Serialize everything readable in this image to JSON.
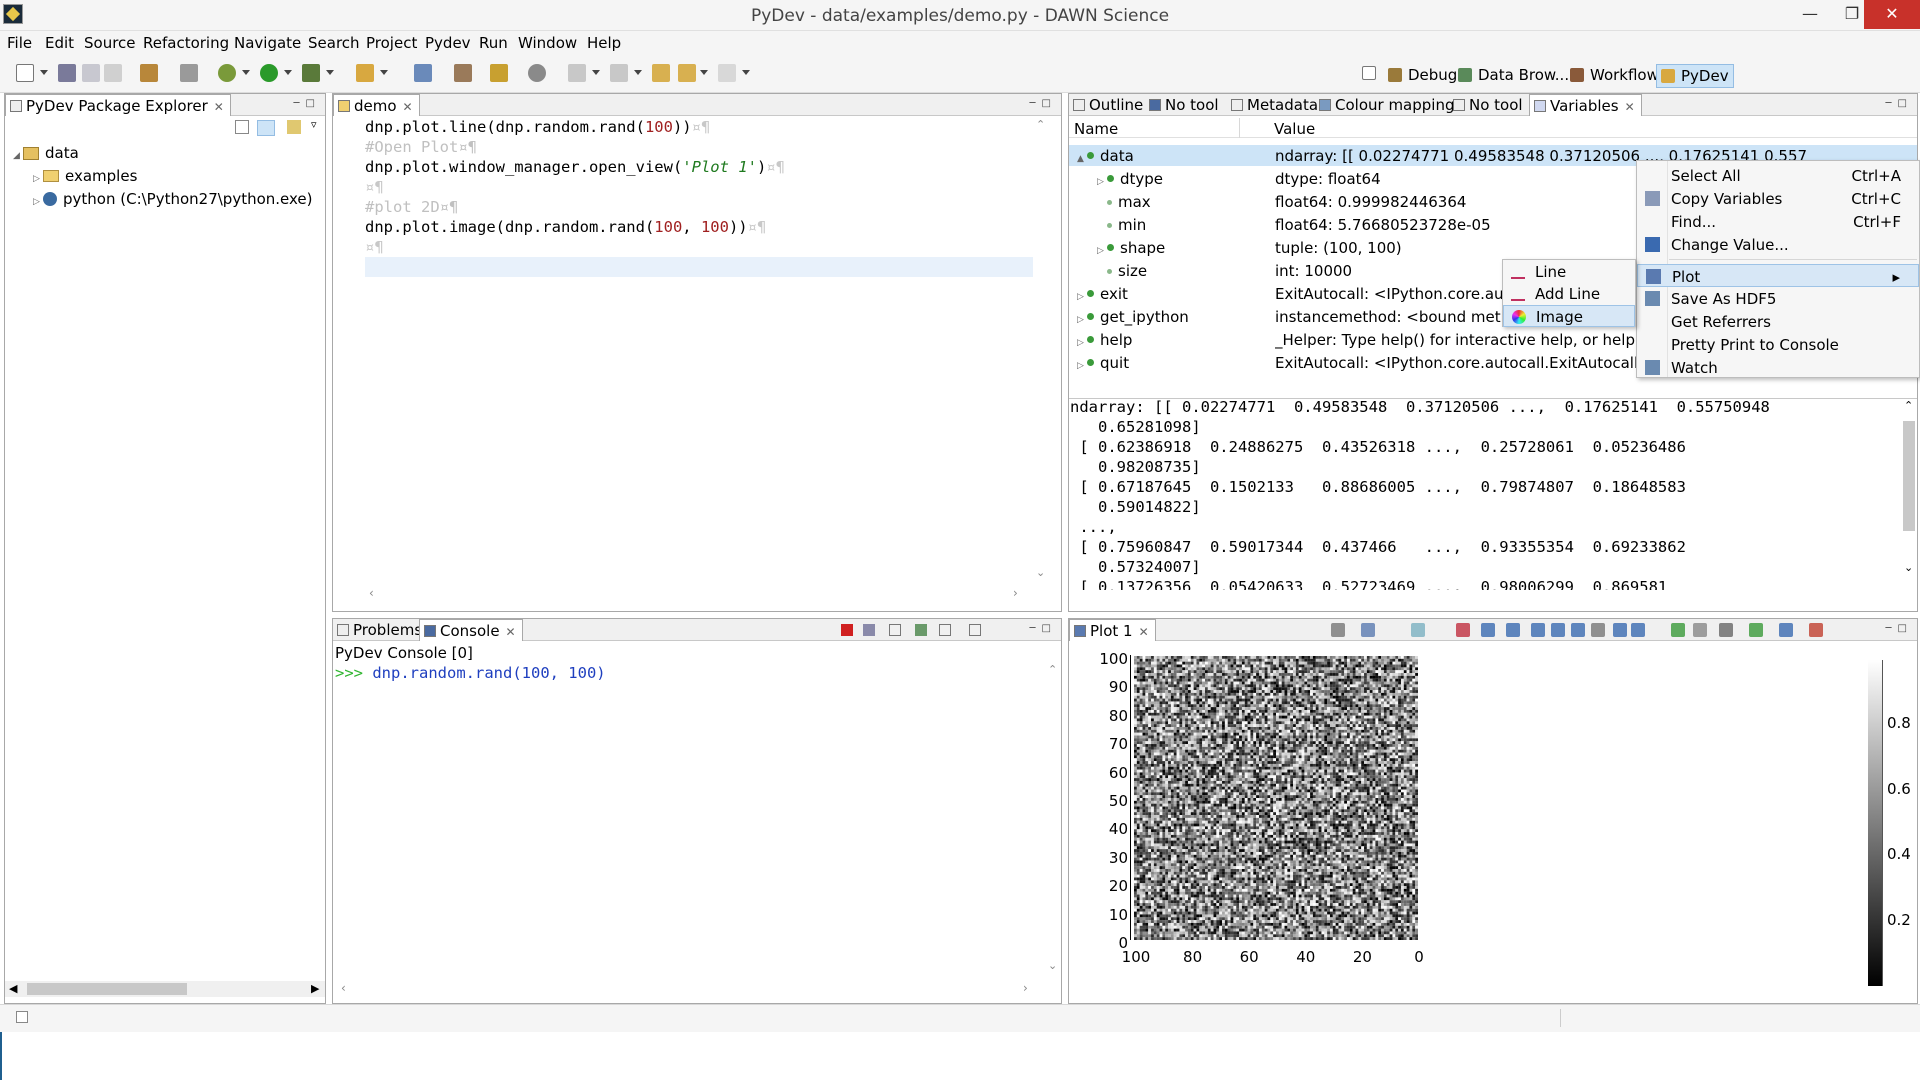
{
  "window": {
    "title": "PyDev - data/examples/demo.py - DAWN Science"
  },
  "menu": [
    "File",
    "Edit",
    "Source",
    "Refactoring",
    "Navigate",
    "Search",
    "Project",
    "Pydev",
    "Run",
    "Window",
    "Help"
  ],
  "perspectives": [
    "Debug",
    "Data Brow...",
    "Workflow",
    "PyDev"
  ],
  "explorer": {
    "tab": "PyDev Package Explorer",
    "root": "data",
    "children": [
      "examples",
      "python  (C:\\Python27\\python.exe)"
    ]
  },
  "editor": {
    "tab": "demo",
    "lines": [
      {
        "type": "code",
        "parts": [
          [
            "dnp.plot.line(dnp.random.rand(",
            ""
          ],
          [
            "100",
            "num"
          ],
          [
            "))",
            ""
          ],
          [
            "¤¶",
            "ws"
          ]
        ]
      },
      {
        "type": "code",
        "parts": [
          [
            "#Open Plot¤¶",
            "comment"
          ]
        ]
      },
      {
        "type": "code",
        "parts": [
          [
            "dnp.plot.window_manager.open_view(",
            ""
          ],
          [
            "'Plot 1'",
            "str"
          ],
          [
            ")",
            ""
          ],
          [
            "¤¶",
            "ws"
          ]
        ]
      },
      {
        "type": "code",
        "parts": [
          [
            "¤¶",
            "ws"
          ]
        ]
      },
      {
        "type": "code",
        "parts": [
          [
            "#plot 2D¤¶",
            "comment"
          ]
        ]
      },
      {
        "type": "code",
        "parts": [
          [
            "dnp.plot.image(dnp.random.rand(",
            ""
          ],
          [
            "100",
            "num"
          ],
          [
            ", ",
            ""
          ],
          [
            "100",
            "num"
          ],
          [
            "))",
            ""
          ],
          [
            "¤¶",
            "ws"
          ]
        ]
      },
      {
        "type": "code",
        "parts": [
          [
            "¤¶",
            "ws"
          ]
        ]
      }
    ]
  },
  "var_tabs": [
    "Outline",
    "No tool",
    "Metadata",
    "Colour mapping",
    "No tool",
    "Variables"
  ],
  "variables": {
    "col_name": "Name",
    "col_value": "Value",
    "rows": [
      {
        "name": "data",
        "value": "ndarray: [[ 0.02274771  0.49583548  0.37120506 ...,  0.17625141  0.557",
        "level": 0,
        "arrow": "▲",
        "selected": true
      },
      {
        "name": "dtype",
        "value": "dtype: float64",
        "level": 1,
        "arrow": "▷"
      },
      {
        "name": "max",
        "value": "float64: 0.999982446364",
        "level": 1,
        "arrow": ""
      },
      {
        "name": "min",
        "value": "float64: 5.76680523728e-05",
        "level": 1,
        "arrow": ""
      },
      {
        "name": "shape",
        "value": "tuple: (100, 100)",
        "level": 1,
        "arrow": "▷"
      },
      {
        "name": "size",
        "value": "int: 10000",
        "level": 1,
        "arrow": ""
      },
      {
        "name": "exit",
        "value": "ExitAutocall: <IPython.core.autoca",
        "level": 0,
        "arrow": "▷"
      },
      {
        "name": "get_ipython",
        "value": "instancemethod: <bound method",
        "level": 0,
        "arrow": "▷"
      },
      {
        "name": "help",
        "value": "_Helper: Type help() for interactive help, or help(objec",
        "level": 0,
        "arrow": "▷"
      },
      {
        "name": "quit",
        "value": "ExitAutocall: <IPython.core.autocall.ExitAutocall objec",
        "level": 0,
        "arrow": "▷"
      }
    ]
  },
  "detail_lines": [
    "ndarray: [[ 0.02274771  0.49583548  0.37120506 ...,  0.17625141  0.55750948",
    "   0.65281098]",
    " [ 0.62386918  0.24886275  0.43526318 ...,  0.25728061  0.05236486",
    "   0.98208735]",
    " [ 0.67187645  0.1502133   0.88686005 ...,  0.79874807  0.18648583",
    "   0.59014822]",
    " ...,",
    " [ 0.75960847  0.59017344  0.437466   ...,  0.93355354  0.69233862",
    "   0.57324007]",
    " [ 0.13726356  0.05420633  0.52723469 ...,  0.98006299  0.869581"
  ],
  "context_menu": [
    {
      "label": "Select All",
      "shortcut": "Ctrl+A"
    },
    {
      "label": "Copy Variables",
      "shortcut": "Ctrl+C"
    },
    {
      "label": "Find...",
      "shortcut": "Ctrl+F"
    },
    {
      "label": "Change Value...",
      "shortcut": ""
    },
    {
      "label": "Plot",
      "shortcut": "▸",
      "highlight": true
    },
    {
      "label": "Save As HDF5",
      "shortcut": ""
    },
    {
      "label": "Get Referrers",
      "shortcut": ""
    },
    {
      "label": "Pretty Print to Console",
      "shortcut": ""
    },
    {
      "label": "Watch",
      "shortcut": ""
    }
  ],
  "plot_submenu": [
    {
      "label": "Line"
    },
    {
      "label": "Add Line"
    },
    {
      "label": "Image",
      "highlight": true
    }
  ],
  "console_tabs": [
    "Problems",
    "Console"
  ],
  "console": {
    "title": "PyDev Console [0]",
    "prompt": ">>>",
    "command": "dnp.random.rand(100, 100)"
  },
  "plot": {
    "tab": "Plot 1",
    "y_ticks": [
      "100",
      "90",
      "80",
      "70",
      "60",
      "50",
      "40",
      "30",
      "20",
      "10",
      "0"
    ],
    "x_ticks": [
      "100",
      "80",
      "60",
      "40",
      "20",
      "0"
    ],
    "colorbar_ticks": [
      "0.8",
      "0.6",
      "0.4",
      "0.2"
    ]
  },
  "chart_data": {
    "type": "heatmap",
    "title": "",
    "rows": 100,
    "cols": 100,
    "value_range": [
      0,
      1
    ],
    "colormap": "grayscale",
    "x_ticks": [
      100,
      80,
      60,
      40,
      20,
      0
    ],
    "y_ticks": [
      100,
      90,
      80,
      70,
      60,
      50,
      40,
      30,
      20,
      10,
      0
    ],
    "colorbar_ticks": [
      0.8,
      0.6,
      0.4,
      0.2
    ],
    "values": "random uniform [0,1) per cell (dnp.random.rand(100, 100))"
  },
  "colors": {
    "selection": "#cde4f7",
    "prompt": "#2fb52f",
    "command": "#1f3fbf",
    "menu_highlight": "#d7e7f6"
  }
}
